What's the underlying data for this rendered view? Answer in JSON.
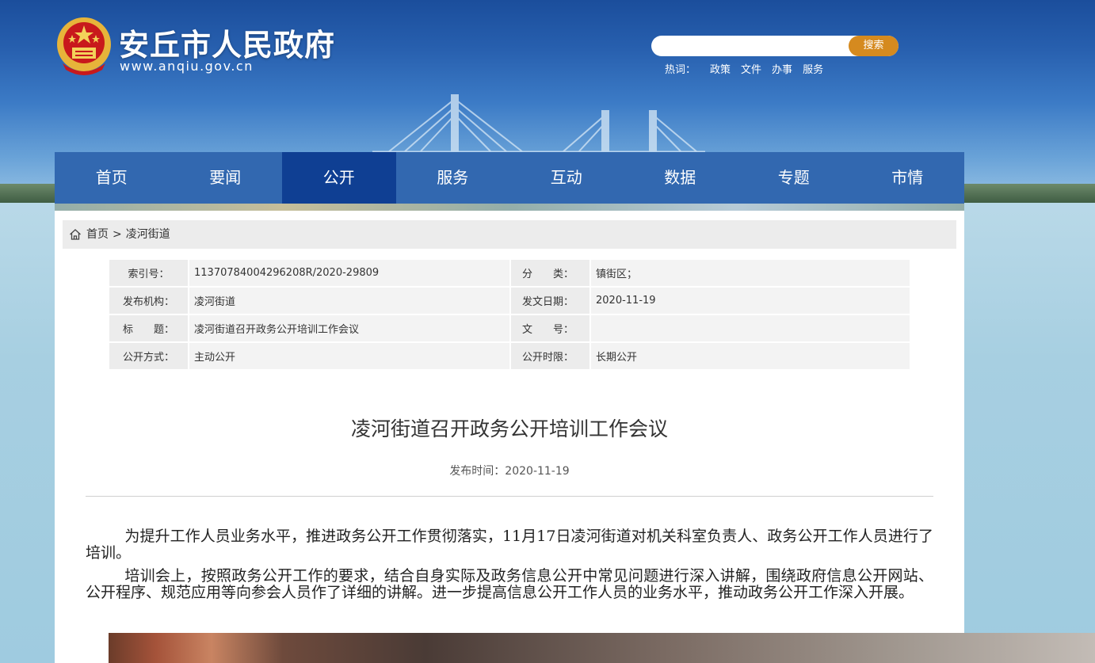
{
  "header": {
    "site_title": "安丘市人民政府",
    "site_url": "www.anqiu.gov.cn",
    "search_placeholder": "",
    "search_button": "搜索",
    "hotwords_label": "热词：",
    "hotwords": [
      "政策",
      "文件",
      "办事",
      "服务"
    ]
  },
  "nav": {
    "items": [
      {
        "label": "首页"
      },
      {
        "label": "要闻"
      },
      {
        "label": "公开"
      },
      {
        "label": "服务"
      },
      {
        "label": "互动"
      },
      {
        "label": "数据"
      },
      {
        "label": "专题"
      },
      {
        "label": "市情"
      }
    ],
    "active_index": 2
  },
  "breadcrumb": {
    "home": "首页",
    "separator": ">",
    "current": "凌河街道"
  },
  "meta": {
    "index_label": "索引号：",
    "index_value": "11370784004296208R/2020-29809",
    "category_label": "分　　类：",
    "category_value": "镇街区；",
    "publisher_label": "发布机构：",
    "publisher_value": "凌河街道",
    "issue_date_label": "发文日期：",
    "issue_date_value": "2020-11-19",
    "title_label": "标　　题：",
    "title_value": "凌河街道召开政务公开培训工作会议",
    "doc_no_label": "文　　号：",
    "doc_no_value": "",
    "open_mode_label": "公开方式：",
    "open_mode_value": "主动公开",
    "open_period_label": "公开时限：",
    "open_period_value": "长期公开"
  },
  "article": {
    "title": "凌河街道召开政务公开培训工作会议",
    "pubtime": "发布时间：2020-11-19",
    "paragraphs": [
      "为提升工作人员业务水平，推进政务公开工作贯彻落实，11月17日凌河街道对机关科室负责人、政务公开工作人员进行了培训。",
      "培训会上，按照政务公开工作的要求，结合自身实际及政务信息公开中常见问题进行深入讲解，围绕政府信息公开网站、公开程序、规范应用等向参会人员作了详细的讲解。进一步提高信息公开工作人员的业务水平，推动政务公开工作深入开展。"
    ]
  },
  "colors": {
    "nav_bg": "#3268b0",
    "nav_active": "#0f3f93",
    "search_button": "#d58a1f"
  }
}
